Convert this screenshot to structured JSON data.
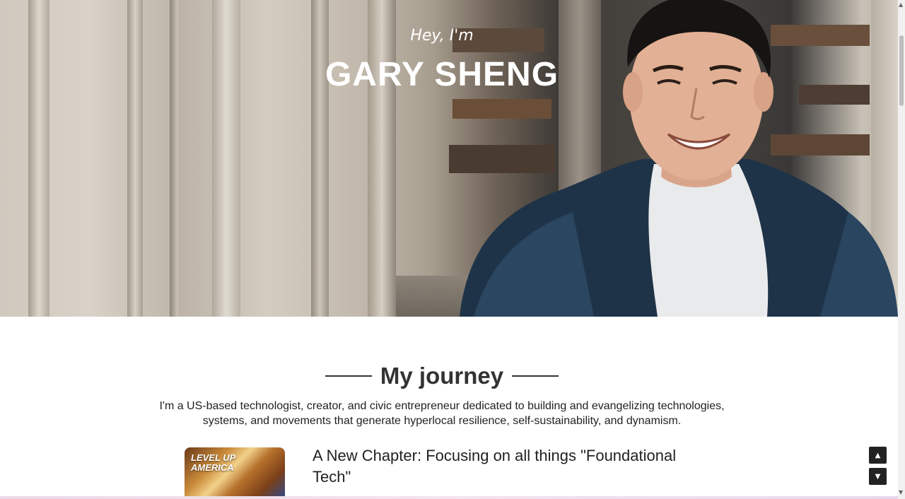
{
  "hero": {
    "greeting": "Hey, I'm",
    "name": "GARY SHENG"
  },
  "journey": {
    "title": "My journey",
    "intro": "I'm a US-based technologist, creator, and civic entrepreneur dedicated to building and evangelizing technologies, systems, and movements that generate hyperlocal resilience, self-sustainability, and dynamism."
  },
  "article": {
    "thumbnail_text": "LEVEL UP AMERICA",
    "title": "A New Chapter: Focusing on all things \"Foundational Tech\""
  },
  "controls": {
    "scroll_up_icon": "triangle-up-icon",
    "scroll_down_icon": "triangle-down-icon",
    "scroll_up_glyph": "▲",
    "scroll_down_glyph": "▼"
  }
}
